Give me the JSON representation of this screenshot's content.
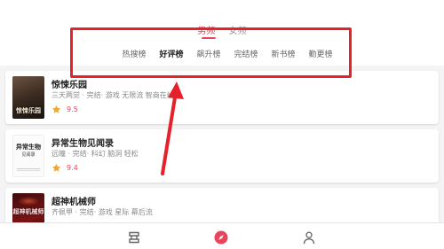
{
  "gender_tabs": [
    {
      "label": "男频",
      "active": true
    },
    {
      "label": "女频",
      "active": false
    }
  ],
  "rank_tabs": [
    "热搜榜",
    "好评榜",
    "飙升榜",
    "完结榜",
    "新书榜",
    "勤更榜"
  ],
  "selected_rank_tab": "好评榜",
  "books": [
    {
      "title": "惊悚乐园",
      "meta": "三天两觉 · 完结· 游戏 无限流 智商在线",
      "score": "9.5",
      "cover_text": "惊悚乐园"
    },
    {
      "title": "异常生物见闻录",
      "meta": "远瞳 · 完结· 科幻 脑洞 轻松",
      "score": "9.4",
      "cover_text": "异常生物",
      "cover_sub": "见闻录"
    },
    {
      "title": "超神机械师",
      "meta": "齐佩甲 · 完结· 游戏 星际 幕后流",
      "cover_text": "超神机械师"
    }
  ],
  "bottom_nav": [
    {
      "icon": "bookshelf-icon"
    },
    {
      "icon": "compass-icon",
      "active": true
    },
    {
      "icon": "person-icon"
    }
  ],
  "colors": {
    "accent": "#e8455d",
    "annotation": "#e6212b",
    "star": "#f5a623"
  }
}
